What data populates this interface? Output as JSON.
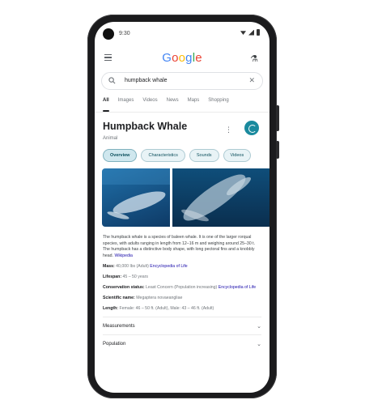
{
  "status_bar": {
    "time": "9:30"
  },
  "app": {
    "logo_letters": [
      "G",
      "o",
      "o",
      "g",
      "l",
      "e"
    ],
    "logo_colors": [
      "#4285F4",
      "#EA4335",
      "#FBBC05",
      "#4285F4",
      "#34A853",
      "#EA4335"
    ]
  },
  "search": {
    "query": "humpback whale"
  },
  "tabs": [
    {
      "label": "All",
      "active": true
    },
    {
      "label": "Images",
      "active": false
    },
    {
      "label": "Videos",
      "active": false
    },
    {
      "label": "News",
      "active": false
    },
    {
      "label": "Maps",
      "active": false
    },
    {
      "label": "Shopping",
      "active": false
    }
  ],
  "knowledge_panel": {
    "title": "Humpback Whale",
    "subtitle": "Animal",
    "chips": [
      "Overview",
      "Characteristics",
      "Sounds",
      "Videos"
    ],
    "description": "The humpback whale is a species of baleen whale. It is one of the larger rorqual species, with adults ranging in length from 12–16 m and weighing around 25–30 t. The humpback has a distinctive body shape, with long pectoral fins and a knobbly head.",
    "description_source": "Wikipedia",
    "facts": [
      {
        "label": "Mass:",
        "value": "40,000 lbs (Adult)",
        "link": "Encyclopedia of Life"
      },
      {
        "label": "Lifespan:",
        "value": "45 – 50 years",
        "link": ""
      },
      {
        "label": "Conservation status:",
        "value": "Least Concern (Population increasing)",
        "link": "Encyclopedia of Life"
      },
      {
        "label": "Scientific name:",
        "value": "Megaptera novaeangliae",
        "link": ""
      },
      {
        "label": "Length:",
        "value": "Female: 46 – 50 ft. (Adult), Male: 43 – 46 ft. (Adult)",
        "link": ""
      }
    ],
    "expanders": [
      "Measurements",
      "Population"
    ]
  },
  "colors": {
    "accent": "#1a8a9e",
    "chip_bg": "#e8f3f6",
    "link": "#1a0dab"
  }
}
